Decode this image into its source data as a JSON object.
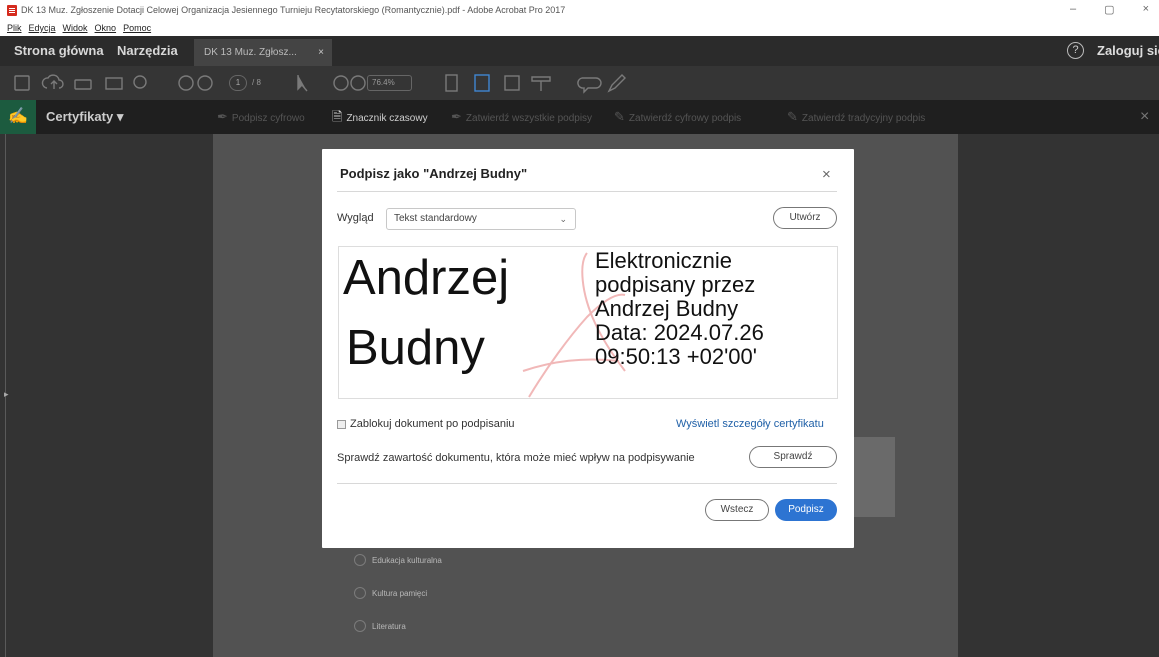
{
  "window": {
    "title": "DK 13 Muz. Zgłoszenie Dotacji Celowej Organizacja Jesiennego Turnieju Recytatorskiego (Romantycznie).pdf - Adobe Acrobat Pro 2017",
    "controls": {
      "minimize": "–",
      "maximize": "▢",
      "close": "×"
    }
  },
  "menu": [
    "Plik",
    "Edycja",
    "Widok",
    "Okno",
    "Pomoc"
  ],
  "tabs": {
    "home": "Strona główna",
    "tools": "Narzędzia",
    "document": "DK 13 Muz. Zgłosz...",
    "close": "×"
  },
  "account": {
    "help_icon": "?",
    "sign_in": "Zaloguj się"
  },
  "toolbar": {
    "page_current": "1",
    "page_total": "/ 8",
    "zoom": "76.4%",
    "icons": [
      "save-icon",
      "upload-icon",
      "print-icon",
      "email-icon",
      "search-icon",
      "page-up-icon",
      "page-down-icon",
      "select-arrow-icon",
      "hand-icon",
      "zoom-out-icon",
      "zoom-in-icon",
      "fit-page-icon",
      "scroll-mode-icon",
      "full-screen-icon",
      "read-mode-icon",
      "comment-icon",
      "highlight-pen-icon"
    ]
  },
  "cert_bar": {
    "title": "Certyfikaty",
    "items": {
      "digital_sign": "Podpisz cyfrowo",
      "timestamp": "Znacznik czasowy",
      "validate_all": "Zatwierdź wszystkie podpisy",
      "validate_digital": "Zatwierdź cyfrowy podpis",
      "validate_traditional": "Zatwierdź tradycyjny podpis"
    },
    "close": "×"
  },
  "document_bg": {
    "options": [
      "Edukacja kulturalna",
      "Kultura pamięci",
      "Literatura"
    ]
  },
  "dialog": {
    "title": "Podpisz jako \"Andrzej Budny\"",
    "close": "×",
    "look_label": "Wygląd",
    "look_value": "Tekst standardowy",
    "create_button": "Utwórz",
    "preview": {
      "name_line1": "Andrzej",
      "name_line2": "Budny",
      "info_lines": [
        "Elektronicznie",
        "podpisany przez",
        "Andrzej Budny",
        "Data: 2024.07.26",
        "09:50:13 +02'00'"
      ]
    },
    "lock_label": "Zablokuj dokument po podpisaniu",
    "cert_details_link": "Wyświetl szczegóły certyfikatu",
    "check_text": "Sprawdź zawartość dokumentu, która może mieć wpływ na podpisywanie",
    "check_button": "Sprawdź",
    "back_button": "Wstecz",
    "sign_button": "Podpisz",
    "accent_color": "#2d74d2"
  }
}
